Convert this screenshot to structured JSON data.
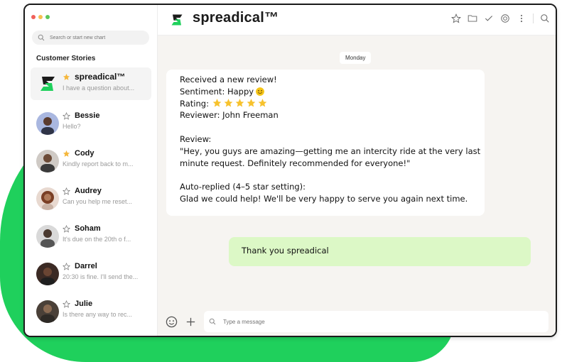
{
  "window": {
    "dot_colors": [
      "#f0605a",
      "#f6bf4f",
      "#5cc65a"
    ]
  },
  "sidebar": {
    "search_placeholder": "Search or start new chart",
    "section_title": "Customer Stories",
    "chats": [
      {
        "name": "spreadical™",
        "preview": "I have a question about...",
        "starred": true,
        "active": true
      },
      {
        "name": "Bessie",
        "preview": "Hello?",
        "starred": false
      },
      {
        "name": "Cody",
        "preview": "Kindly report back to m...",
        "starred": true
      },
      {
        "name": "Audrey",
        "preview": "Can you help me reset...",
        "starred": false
      },
      {
        "name": "Soham",
        "preview": "It's due on the 20th o f...",
        "starred": false
      },
      {
        "name": "Darrel",
        "preview": "20:30 is fine. I'll send the...",
        "starred": false
      },
      {
        "name": "Julie",
        "preview": "Is there any way to rec...",
        "starred": false
      }
    ]
  },
  "header": {
    "brand": "spreadical™",
    "tools": [
      "star-icon",
      "folder-icon",
      "check-icon",
      "target-icon",
      "more-vertical-icon",
      "search-icon"
    ]
  },
  "conversation": {
    "day_label": "Monday",
    "incoming": {
      "line1": "Received a new review!",
      "sentiment": "Sentiment: Happy",
      "rating": "Rating:",
      "rating_stars": 5,
      "reviewer": "Reviewer: John Freeman",
      "review_label": "Review:",
      "review_line1": "\"Hey, you guys are amazing—getting me an intercity ride at the very last",
      "review_line2": "minute request. Definitely recommended for everyone!\"",
      "auto_label": "Auto-replied (4–5 star setting):",
      "auto_text": "Glad we could help! We'll be very happy to serve you again next time."
    },
    "outgoing": {
      "text": "Thank you spreadical"
    }
  },
  "composer": {
    "placeholder": "Type a message"
  },
  "colors": {
    "brand_green": "#1fd05c",
    "outgoing_bubble": "#dcf8c6",
    "star_gold": "#f5b73b"
  }
}
